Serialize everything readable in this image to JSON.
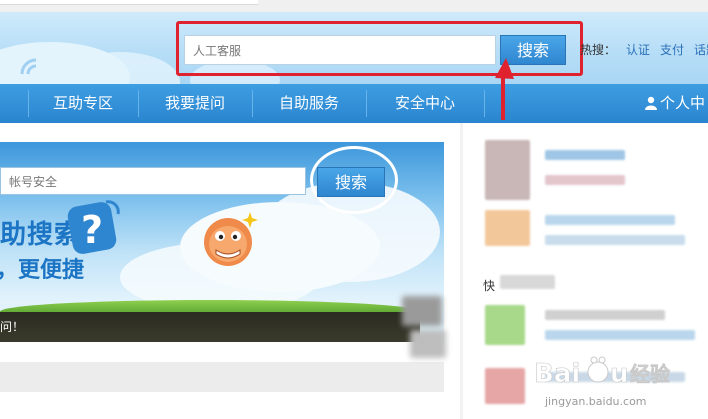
{
  "header": {
    "search": {
      "value": "人工客服",
      "button_label": "搜索"
    },
    "hot_searches": {
      "label": "热搜：",
      "items": [
        "认证",
        "支付",
        "话题"
      ]
    }
  },
  "nav": {
    "items": [
      "互助专区",
      "我要提问",
      "自助服务",
      "安全中心"
    ],
    "user_label": "个人中"
  },
  "banner": {
    "search": {
      "value": "帐号安全",
      "button_label": "搜索"
    },
    "slogan_line1": "助搜索",
    "slogan_line2": "，更便捷",
    "ticker_text": "问！"
  },
  "sidebar": {
    "snippet": "快"
  },
  "watermark": {
    "brand": "Baidu经验",
    "url": "jingyan.baidu.com"
  },
  "colors": {
    "highlight_frame": "#e0212e",
    "nav_blue": "#2a84cf",
    "button_blue": "#2f86d0",
    "arrow_red": "#e0212e"
  }
}
